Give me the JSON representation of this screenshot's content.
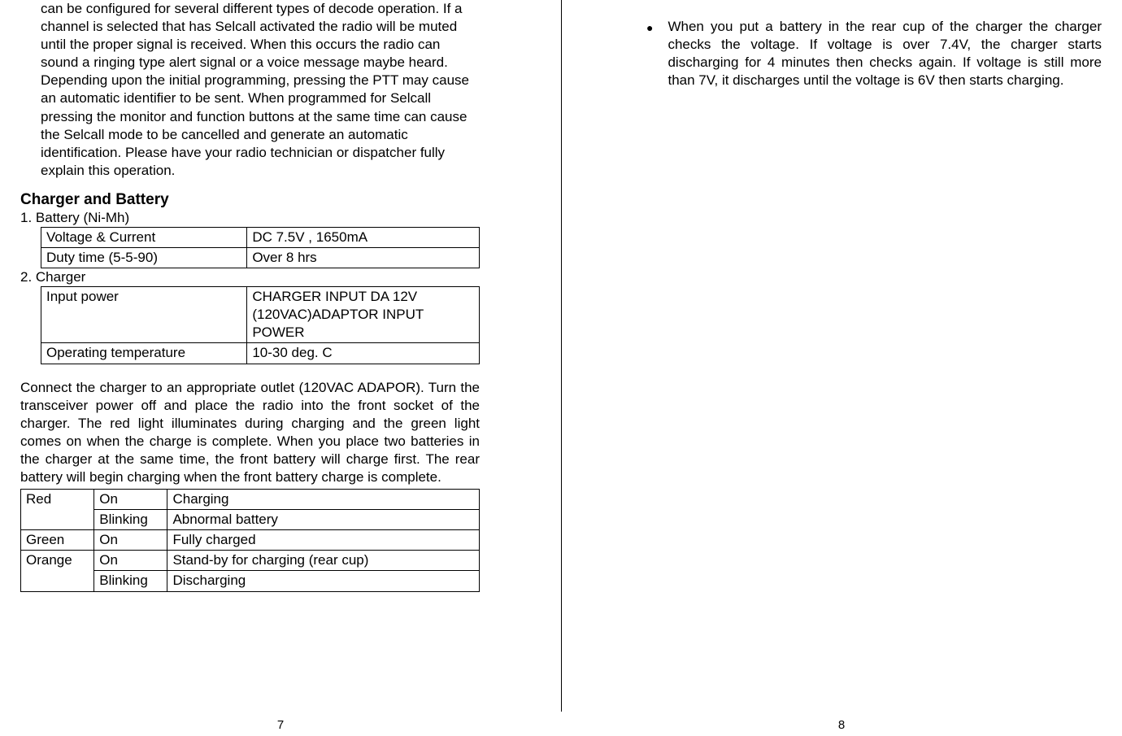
{
  "page_left": {
    "intro_para": "can be configured for several different types of decode operation. If a channel is selected that has Selcall activated the radio will be muted until the proper signal is received. When this occurs the radio can sound a ringing type alert signal or a voice message maybe heard. Depending upon the initial programming, pressing the PTT may cause an automatic identifier to be sent. When programmed for Selcall pressing the monitor and function buttons at the same time can cause the Selcall mode to be cancelled and generate an automatic identification. Please have your radio technician or dispatcher fully explain this operation.",
    "section_title": "Charger and Battery",
    "battery_label": "1. Battery (Ni-Mh)",
    "battery_table": {
      "row1": {
        "label": "Voltage & Current",
        "value": "DC 7.5V , 1650mA"
      },
      "row2": {
        "label": "Duty time (5-5-90)",
        "value": "Over 8 hrs"
      }
    },
    "charger_label": "2. Charger",
    "charger_table": {
      "row1": {
        "label": "Input power",
        "value": " CHARGER INPUT DA 12V (120VAC)ADAPTOR INPUT POWER"
      },
      "row2": {
        "label": "Operating temperature",
        "value": "10-30 deg. C"
      }
    },
    "connect_para": "Connect the charger to an appropriate outlet (120VAC ADAPOR). Turn the transceiver power off and place the radio into the front socket of the charger. The red light illuminates during charging and the green light comes on when the charge is complete. When you place two batteries in the charger at the same time, the front battery will charge first. The rear battery will begin charging when the front battery charge is complete.",
    "led_table": {
      "red": {
        "label": "Red",
        "on": "On",
        "on_status": "Charging",
        "blinking": "Blinking",
        "blinking_status": "Abnormal battery"
      },
      "green": {
        "label": "Green",
        "on": "On",
        "on_status": "Fully charged"
      },
      "orange": {
        "label": "Orange",
        "on": "On",
        "on_status": "Stand-by for charging (rear cup)",
        "blinking": "Blinking",
        "blinking_status": "Discharging"
      }
    },
    "page_number": "7"
  },
  "page_right": {
    "bullet_text": "When you put a battery in the rear cup of the charger the charger checks the voltage. If voltage is over 7.4V, the charger starts discharging for 4 minutes then checks again. If voltage is still more than 7V, it discharges until the voltage is 6V then starts charging.",
    "page_number": "8"
  }
}
